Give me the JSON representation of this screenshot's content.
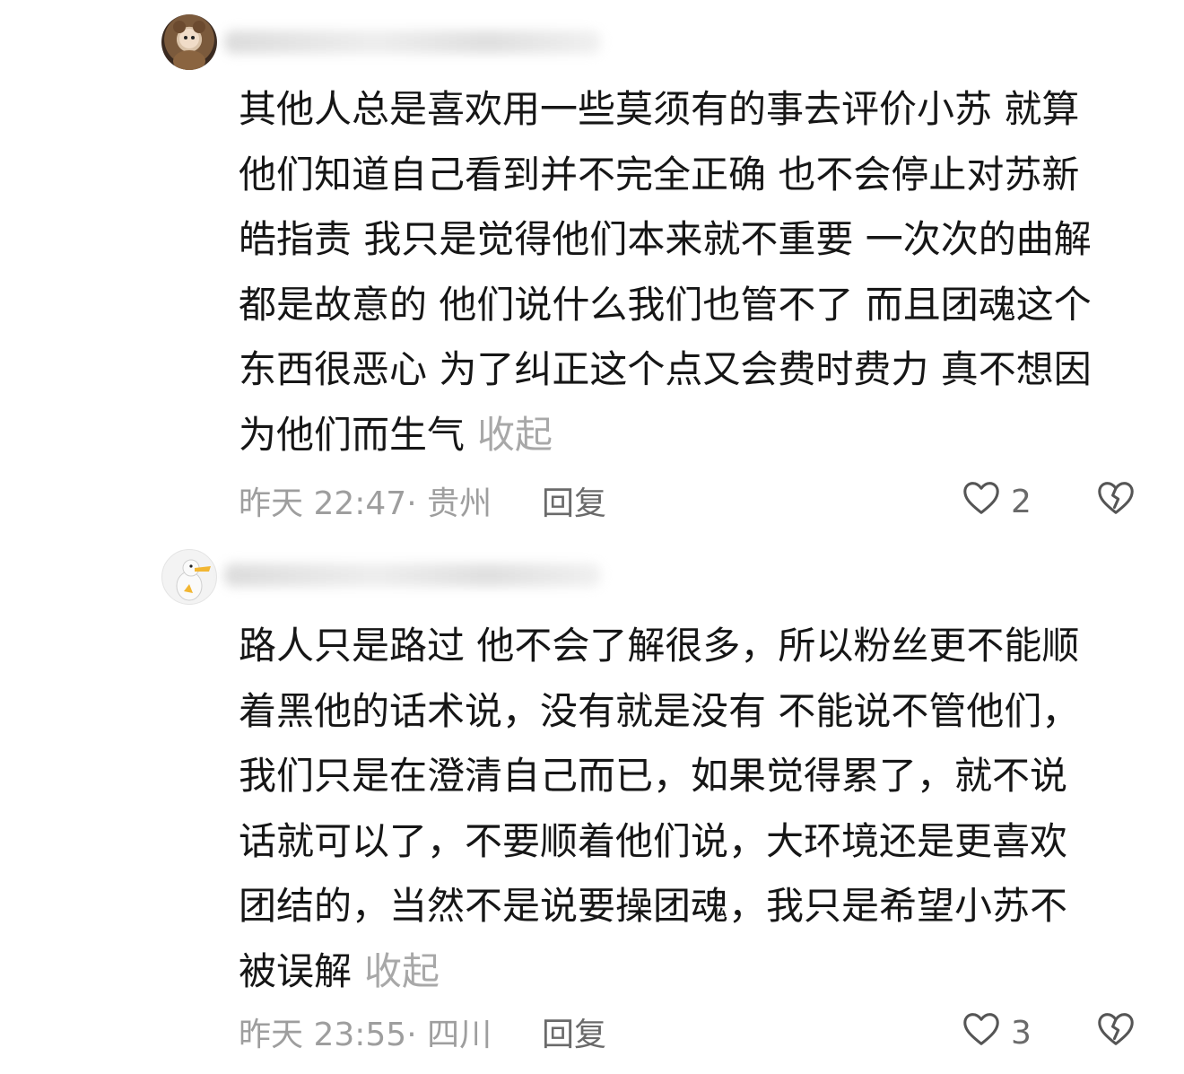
{
  "comments": [
    {
      "text": "其他人总是喜欢用一些莫须有的事去评价小苏 就算\n他们知道自己看到并不完全正确 也不会停止对苏新\n皓指责 我只是觉得他们本来就不重要  一次次的曲解\n都是故意的 他们说什么我们也管不了  而且团魂这个\n东西很恶心  为了纠正这个点又会费时费力 真不想因\n为他们而生气",
      "collapse_label": "收起",
      "time_location": "昨天 22:47· 贵州",
      "reply_label": "回复",
      "like_count": "2",
      "like_icon": "heart-outline-icon",
      "dislike_icon": "broken-heart-icon"
    },
    {
      "text": "路人只是路过 他不会了解很多，所以粉丝更不能顺\n着黑他的话术说，没有就是没有 不能说不管他们，\n我们只是在澄清自己而已，如果觉得累了，就不说\n话就可以了，不要顺着他们说，大环境还是更喜欢\n团结的，当然不是说要操团魂，我只是希望小苏不\n被误解",
      "collapse_label": "收起",
      "time_location": "昨天 23:55· 四川",
      "reply_label": "回复",
      "like_count": "3",
      "like_icon": "heart-outline-icon",
      "dislike_icon": "broken-heart-icon"
    }
  ],
  "colors": {
    "text": "#161616",
    "muted": "#9e9e9e",
    "action": "#6a6a6a",
    "icon_stroke": "#555555"
  }
}
